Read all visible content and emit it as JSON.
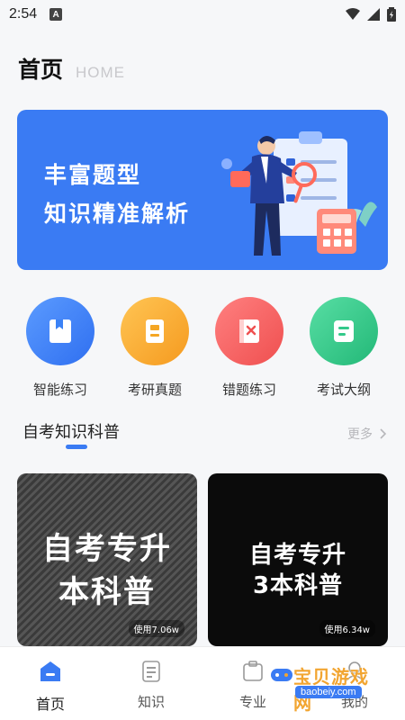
{
  "status": {
    "time": "2:54",
    "notification_icon": "A"
  },
  "header": {
    "title": "首页",
    "subtitle": "HOME"
  },
  "banner": {
    "line1": "丰富题型",
    "line2": "知识精准解析"
  },
  "quick_actions": [
    {
      "label": "智能练习",
      "color": "#3b82f6",
      "icon": "book-icon"
    },
    {
      "label": "考研真题",
      "color": "#f5a623",
      "icon": "document-icon"
    },
    {
      "label": "错题练习",
      "color": "#f05a5a",
      "icon": "wrong-book-icon"
    },
    {
      "label": "考试大纲",
      "color": "#33c98a",
      "icon": "outline-icon"
    }
  ],
  "section": {
    "title": "自考知识科普",
    "more": "更多"
  },
  "cards": [
    {
      "line1": "自考专升",
      "line2": "本科普",
      "usage": "使用7.06w"
    },
    {
      "line1": "自考专升",
      "line2": "3本科普",
      "usage": "使用6.34w"
    }
  ],
  "tabs": [
    {
      "label": "首页",
      "icon": "home-icon"
    },
    {
      "label": "知识",
      "icon": "knowledge-icon"
    },
    {
      "label": "专业",
      "icon": "major-icon"
    },
    {
      "label": "我的",
      "icon": "profile-icon"
    }
  ],
  "watermark": {
    "text": "宝贝游戏网",
    "url": "baobeiy.com"
  }
}
